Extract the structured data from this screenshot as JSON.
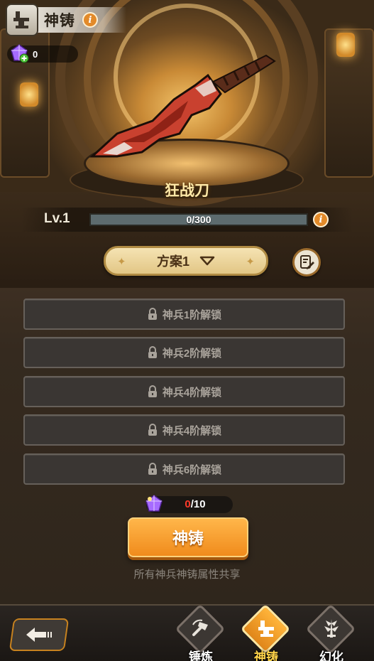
{
  "header": {
    "title": "神铸"
  },
  "currency": {
    "count": "0"
  },
  "weapon": {
    "name": "狂战刀"
  },
  "level": {
    "label": "Lv.1",
    "xp_text": "0/300",
    "xp_progress": 0
  },
  "plan": {
    "label": "方案1"
  },
  "slots": [
    {
      "label": "神兵1阶解锁"
    },
    {
      "label": "神兵2阶解锁"
    },
    {
      "label": "神兵4阶解锁"
    },
    {
      "label": "神兵4阶解锁"
    },
    {
      "label": "神兵6阶解锁"
    }
  ],
  "cost": {
    "have": "0",
    "need": "/10"
  },
  "forge_button": {
    "label": "神铸"
  },
  "share_note": "所有神兵神铸属性共享",
  "nav": [
    {
      "label": "锤炼",
      "icon": "hammer-icon",
      "active": false
    },
    {
      "label": "神铸",
      "icon": "anvil-icon",
      "active": true
    },
    {
      "label": "幻化",
      "icon": "spiked-sword-icon",
      "active": false
    }
  ],
  "colors": {
    "accent": "#f08b1c",
    "active_tab": "#ffd34a",
    "cost_short": "#ff3a2a"
  }
}
